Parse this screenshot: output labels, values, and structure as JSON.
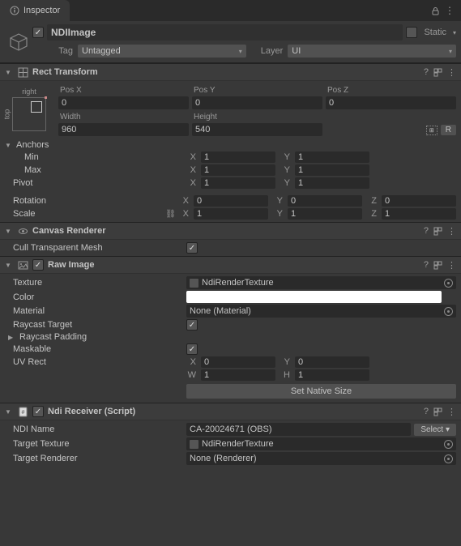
{
  "tab": {
    "title": "Inspector"
  },
  "header": {
    "active": true,
    "name": "NDIImage",
    "static_label": "Static",
    "tag_label": "Tag",
    "tag_value": "Untagged",
    "layer_label": "Layer",
    "layer_value": "UI"
  },
  "rect_transform": {
    "title": "Rect Transform",
    "anchor_top": "right",
    "anchor_side": "top",
    "posx_l": "Pos X",
    "posx": "0",
    "posy_l": "Pos Y",
    "posy": "0",
    "posz_l": "Pos Z",
    "posz": "0",
    "width_l": "Width",
    "width": "960",
    "height_l": "Height",
    "height": "540",
    "r_button": "R",
    "anchors_l": "Anchors",
    "min_l": "Min",
    "min_x": "1",
    "min_y": "1",
    "max_l": "Max",
    "max_x": "1",
    "max_y": "1",
    "pivot_l": "Pivot",
    "pivot_x": "1",
    "pivot_y": "1",
    "rotation_l": "Rotation",
    "rot_x": "0",
    "rot_y": "0",
    "rot_z": "0",
    "scale_l": "Scale",
    "scale_x": "1",
    "scale_y": "1",
    "scale_z": "1"
  },
  "canvas_renderer": {
    "title": "Canvas Renderer",
    "cull_l": "Cull Transparent Mesh",
    "cull": true
  },
  "raw_image": {
    "title": "Raw Image",
    "texture_l": "Texture",
    "texture": "NdiRenderTexture",
    "color_l": "Color",
    "material_l": "Material",
    "material": "None (Material)",
    "raycast_l": "Raycast Target",
    "raycast": true,
    "padding_l": "Raycast Padding",
    "maskable_l": "Maskable",
    "maskable": true,
    "uvrect_l": "UV Rect",
    "uv_x": "0",
    "uv_y": "0",
    "uv_w": "1",
    "uv_h": "1",
    "native_btn": "Set Native Size"
  },
  "ndi_receiver": {
    "title": "Ndi Receiver (Script)",
    "name_l": "NDI Name",
    "name": "CA-20024671 (OBS)",
    "select_btn": "Select",
    "target_tex_l": "Target Texture",
    "target_tex": "NdiRenderTexture",
    "target_rend_l": "Target Renderer",
    "target_rend": "None (Renderer)"
  }
}
